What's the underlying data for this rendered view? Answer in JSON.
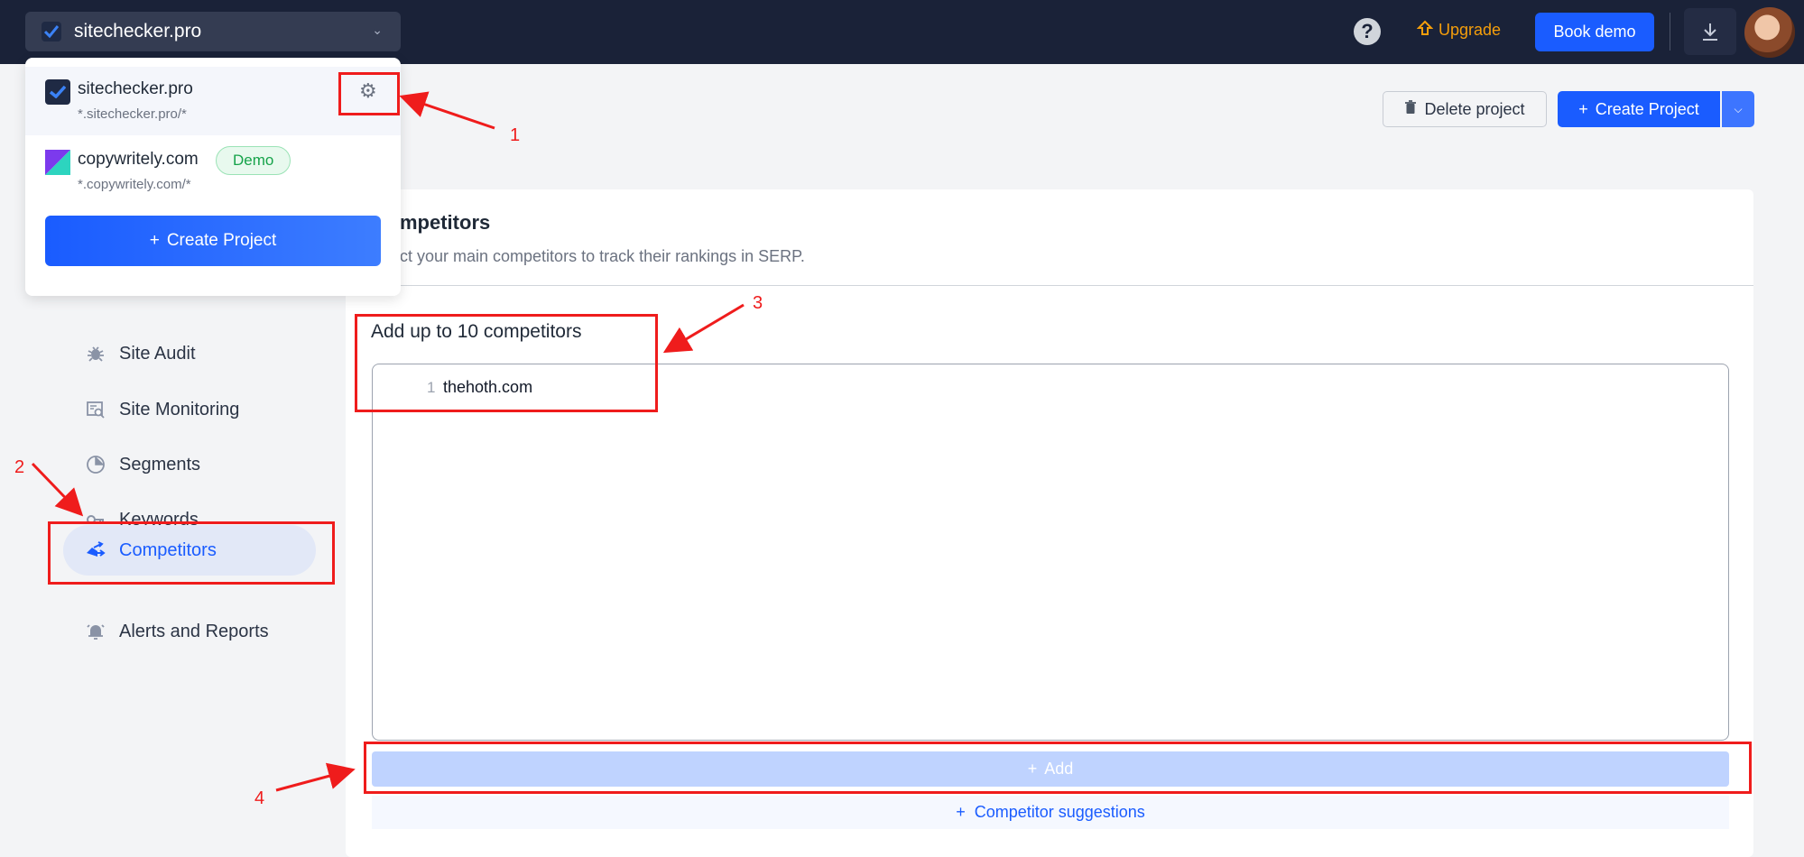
{
  "topbar": {
    "project_name": "sitechecker.pro",
    "help_label": "?",
    "upgrade_label": "Upgrade",
    "book_demo_label": "Book demo"
  },
  "dropdown": {
    "projects": [
      {
        "name": "sitechecker.pro",
        "url": "*.sitechecker.pro/*"
      },
      {
        "name": "copywritely.com",
        "url": "*.copywritely.com/*",
        "badge": "Demo"
      }
    ],
    "create_label": "Create Project"
  },
  "sidebar": {
    "items": [
      {
        "label": "Site Audit",
        "icon": "bug-icon"
      },
      {
        "label": "Site Monitoring",
        "icon": "monitor-search-icon"
      },
      {
        "label": "Segments",
        "icon": "pie-icon"
      },
      {
        "label": "Keywords",
        "icon": "key-icon"
      },
      {
        "label": "Competitors",
        "icon": "competitors-icon",
        "active": true
      },
      {
        "label": "Alerts and Reports",
        "icon": "bell-icon"
      }
    ]
  },
  "header_actions": {
    "delete_label": "Delete project",
    "create_label": "Create Project"
  },
  "competitors": {
    "title": "mpetitors",
    "subtitle": "ct your main competitors to track their rankings in SERP.",
    "add_heading": "Add up to 10 competitors",
    "line_number": "1",
    "entry": "thehoth.com",
    "add_button": "Add",
    "suggestions_button": "Competitor suggestions"
  },
  "annotations": [
    "1",
    "2",
    "3",
    "4"
  ],
  "colors": {
    "accent": "#1a5cff",
    "topbar": "#1a2238",
    "annotation": "#ef1c1c",
    "upgrade": "#f59e0b"
  }
}
